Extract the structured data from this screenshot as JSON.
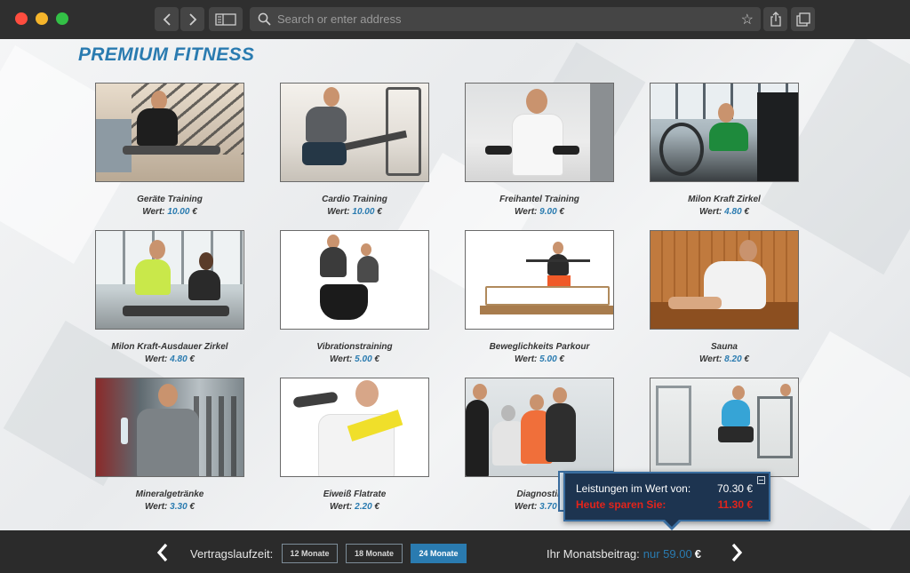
{
  "browser": {
    "address_placeholder": "Search or enter address"
  },
  "page": {
    "brand": "PREMIUM FITNESS",
    "price_prefix": "Wert:",
    "currency": "€",
    "services": [
      {
        "name": "Geräte Training",
        "value": "10.00"
      },
      {
        "name": "Cardio Training",
        "value": "10.00"
      },
      {
        "name": "Freihantel Training",
        "value": "9.00"
      },
      {
        "name": "Milon Kraft Zirkel",
        "value": "4.80"
      },
      {
        "name": "Milon Kraft-Ausdauer Zirkel",
        "value": "4.80"
      },
      {
        "name": "Vibrationstraining",
        "value": "5.00"
      },
      {
        "name": "Beweglichkeits Parkour",
        "value": "5.00"
      },
      {
        "name": "Sauna",
        "value": "8.20"
      },
      {
        "name": "Mineralgetränke",
        "value": "3.30"
      },
      {
        "name": "Eiweiß Flatrate",
        "value": "2.20"
      },
      {
        "name": "Diagnostik",
        "value": "3.70"
      },
      {
        "name": "",
        "value": ""
      }
    ]
  },
  "summary": {
    "label_value": "Leistungen im Wert von:",
    "total": "70.30 €",
    "label_save": "Heute sparen Sie:",
    "savings": "11.30 €"
  },
  "footer": {
    "duration_label": "Vertragslaufzeit:",
    "options": [
      "12 Monate",
      "18 Monate",
      "24 Monate"
    ],
    "selected": "24 Monate",
    "monthly_label": "Ihr Monatsbeitrag:",
    "monthly_value": "nur 59.00",
    "monthly_currency": "€"
  },
  "colors": {
    "accent": "#2a7bb0",
    "savings_red": "#e3241b",
    "popup_bg": "#1d3450"
  }
}
